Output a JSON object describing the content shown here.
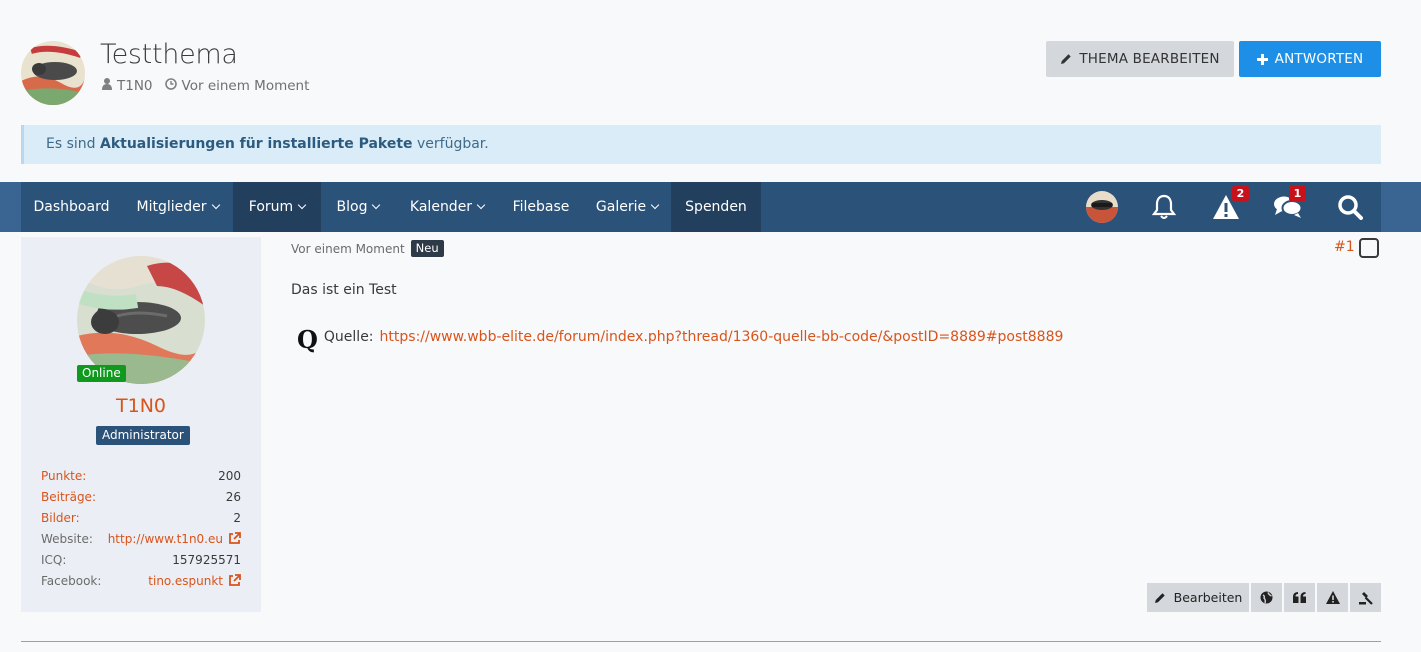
{
  "thread": {
    "title": "Testthema",
    "author": "T1N0",
    "time": "Vor einem Moment"
  },
  "buttons": {
    "edit_thread": "THEMA BEARBEITEN",
    "reply": "ANTWORTEN"
  },
  "notice": {
    "prefix": "Es sind ",
    "link": "Aktualisierungen für installierte Pakete",
    "suffix": " verfügbar."
  },
  "nav": {
    "items": [
      {
        "label": "Dashboard",
        "has_menu": false
      },
      {
        "label": "Mitglieder",
        "has_menu": true
      },
      {
        "label": "Forum",
        "has_menu": true,
        "active": true
      },
      {
        "label": "Blog",
        "has_menu": true
      },
      {
        "label": "Kalender",
        "has_menu": true
      },
      {
        "label": "Filebase",
        "has_menu": false
      },
      {
        "label": "Galerie",
        "has_menu": true
      },
      {
        "label": "Spenden",
        "has_menu": false
      }
    ],
    "moderation_badge": "2",
    "conversations_badge": "1",
    "icons": [
      "user-avatar",
      "bell-icon",
      "warning-icon",
      "comments-icon",
      "search-icon"
    ]
  },
  "user": {
    "name": "T1N0",
    "status": "Online",
    "rank": "Administrator",
    "stats": [
      {
        "key": "Punkte:",
        "value": "200"
      },
      {
        "key": "Beiträge:",
        "value": "26"
      },
      {
        "key": "Bilder:",
        "value": "2"
      },
      {
        "key": "Website:",
        "value": "http://www.t1n0.eu"
      },
      {
        "key": "ICQ:",
        "value": "157925571"
      },
      {
        "key": "Facebook:",
        "value": "tino.espunkt"
      }
    ]
  },
  "post": {
    "time": "Vor einem Moment",
    "new_tag": "Neu",
    "number": "#1",
    "text": "Das ist ein Test",
    "source_label": "Quelle:",
    "source_url": "https://www.wbb-elite.de/forum/index.php?thread/1360-quelle-bb-code/&postID=8889#post8889",
    "source_icon": "Q"
  },
  "post_actions": {
    "edit": "Bearbeiten"
  },
  "colors": {
    "accent": "#d8541b",
    "nav_bg": "#2b5279",
    "nav_active": "#233f5e",
    "reply_btn": "#1e8fe6",
    "badge": "#c7121b",
    "online": "#0f9a1e"
  }
}
